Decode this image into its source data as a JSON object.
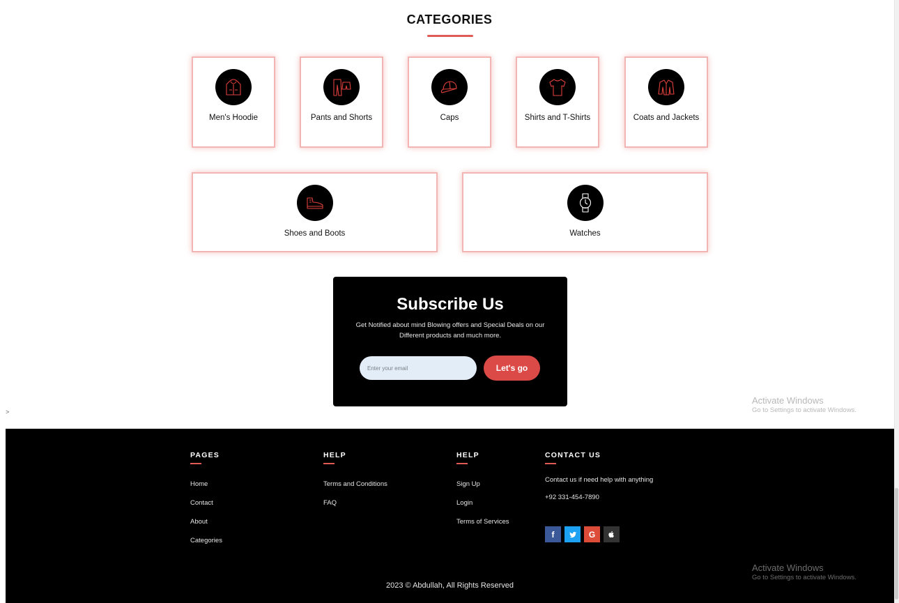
{
  "categories": {
    "title": "CATEGORIES",
    "items": [
      {
        "label": "Men's Hoodie",
        "icon": "hoodie-icon"
      },
      {
        "label": "Pants and Shorts",
        "icon": "pants-icon"
      },
      {
        "label": "Caps",
        "icon": "cap-icon"
      },
      {
        "label": "Shirts and T-Shirts",
        "icon": "tshirt-icon"
      },
      {
        "label": "Coats and Jackets",
        "icon": "jacket-icon"
      },
      {
        "label": "Shoes and Boots",
        "icon": "shoe-icon"
      },
      {
        "label": "Watches",
        "icon": "watch-icon"
      }
    ]
  },
  "subscribe": {
    "title": "Subscribe Us",
    "text": "Get Notified about mind Blowing offers and Special Deals on our Different products and much more.",
    "placeholder": "Enter your email",
    "button": "Let's go"
  },
  "stray_text": ">",
  "activate_windows": {
    "line1": "Activate Windows",
    "line2": "Go to Settings to activate Windows."
  },
  "footer": {
    "pages": {
      "title": "PAGES",
      "links": [
        "Home",
        "Contact",
        "About",
        "Categories"
      ]
    },
    "help1": {
      "title": "HELP",
      "links": [
        "Terms and Conditions",
        "FAQ"
      ]
    },
    "help2": {
      "title": "HELP",
      "links": [
        "Sign Up",
        "Login",
        "Terms of Services"
      ]
    },
    "contact": {
      "title": "CONTACT US",
      "text": "Contact us if need help with anything",
      "phone": "+92 331-454-7890",
      "social": [
        {
          "name": "facebook-icon",
          "glyph": "f",
          "color": "#3b5998"
        },
        {
          "name": "twitter-icon",
          "glyph": "t",
          "color": "#1da1f2"
        },
        {
          "name": "google-icon",
          "glyph": "G",
          "color": "#dd4b39"
        },
        {
          "name": "apple-icon",
          "glyph": "",
          "color": "#333333"
        }
      ]
    },
    "copyright": "2023 © Abdullah, All Rights Reserved"
  },
  "colors": {
    "accent": "#e05a56",
    "card_border": "#f3b5b3",
    "button": "#dc4a48",
    "footer_bg": "#000000",
    "input_bg": "#e3edf7"
  }
}
